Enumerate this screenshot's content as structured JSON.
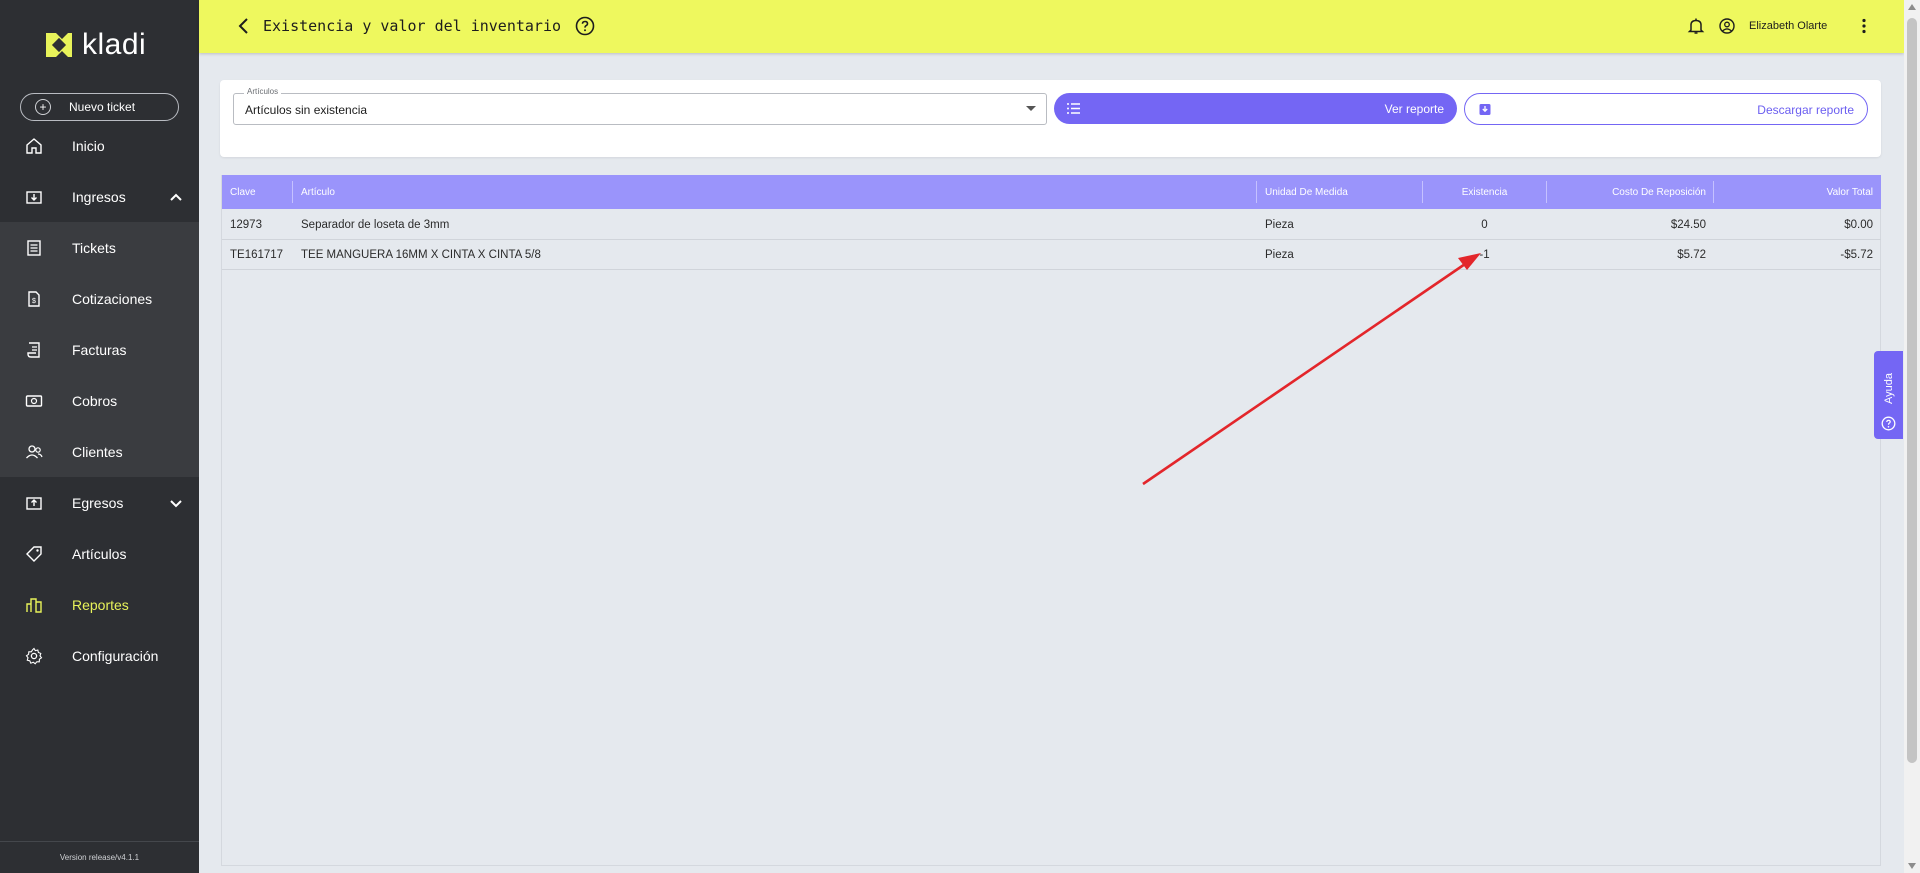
{
  "app": {
    "brand": "kladi",
    "version": "Version release/v4.1.1"
  },
  "sidebar": {
    "new_ticket_label": "Nuevo ticket",
    "items": [
      {
        "label": "Inicio",
        "icon": "home-icon"
      },
      {
        "label": "Ingresos",
        "icon": "income-icon"
      },
      {
        "label": "Tickets",
        "icon": "ticket-icon"
      },
      {
        "label": "Cotizaciones",
        "icon": "quote-icon"
      },
      {
        "label": "Facturas",
        "icon": "invoice-icon"
      },
      {
        "label": "Cobros",
        "icon": "payments-icon"
      },
      {
        "label": "Clientes",
        "icon": "clients-icon"
      },
      {
        "label": "Egresos",
        "icon": "expenses-icon"
      },
      {
        "label": "Artículos",
        "icon": "tag-icon"
      },
      {
        "label": "Reportes",
        "icon": "reports-icon"
      },
      {
        "label": "Configuración",
        "icon": "gear-icon"
      }
    ],
    "active_color": "#e8f35a"
  },
  "header": {
    "title": "Existencia y valor del inventario",
    "user_name": "Elizabeth Olarte",
    "background": "#eef85e"
  },
  "filters": {
    "select_label": "Artículos",
    "select_value": "Artículos sin existencia",
    "view_report_label": "Ver reporte",
    "download_report_label": "Descargar reporte",
    "accent": "#7466f4"
  },
  "table": {
    "columns": [
      "Clave",
      "Artículo",
      "Unidad De Medida",
      "Existencia",
      "Costo De Reposición",
      "Valor Total"
    ],
    "rows": [
      {
        "clave": "12973",
        "articulo": "Separador de loseta de 3mm",
        "unidad": "Pieza",
        "existencia": "0",
        "costo": "$24.50",
        "valor": "$0.00"
      },
      {
        "clave": "TE161717",
        "articulo": "TEE MANGUERA 16MM X CINTA X CINTA 5/8",
        "unidad": "Pieza",
        "existencia": "-1",
        "costo": "$5.72",
        "valor": "-$5.72"
      }
    ]
  },
  "help_tab": {
    "label": "Ayuda"
  }
}
